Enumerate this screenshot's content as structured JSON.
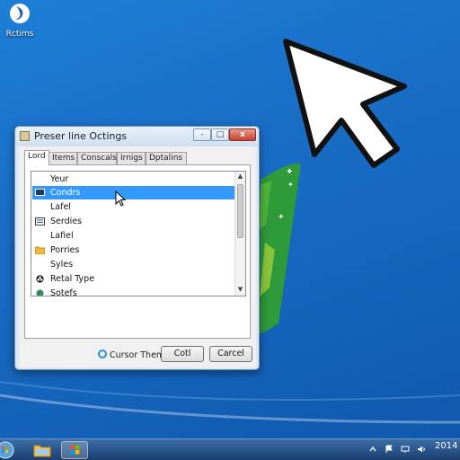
{
  "desktop": {
    "icon_label": "Rctims"
  },
  "dialog": {
    "title": "Preser line Octings",
    "controls": {
      "minimize": "-",
      "maximize": "□",
      "close": "x"
    },
    "tabs": [
      {
        "label": "Lord"
      },
      {
        "label": "Items"
      },
      {
        "label": "Conscals"
      },
      {
        "label": "Irnigs"
      },
      {
        "label": "Dptalins"
      }
    ],
    "list": {
      "items": [
        {
          "label": "Yeur",
          "icon": "none"
        },
        {
          "label": "Condrs",
          "icon": "monitor-icon",
          "selected": true
        },
        {
          "label": "Lafel",
          "icon": "none"
        },
        {
          "label": "Serdies",
          "icon": "list-icon"
        },
        {
          "label": "Lafiel",
          "icon": "none"
        },
        {
          "label": "Porries",
          "icon": "folder-icon"
        },
        {
          "label": "Syles",
          "icon": "none"
        },
        {
          "label": "Retal Type",
          "icon": "clover-icon"
        },
        {
          "label": "Sotefs",
          "icon": "globe-icon"
        }
      ],
      "scroll_up": "▲",
      "scroll_down": "▼"
    },
    "theme_link": "Cursor Theme",
    "ok_label": "Cotl",
    "cancel_label": "Carcel"
  },
  "taskbar": {
    "clock": "2014"
  },
  "colors": {
    "desktop": "#1a6ec6",
    "selection": "#3399ff",
    "dialog_frame": "#dce8f4"
  }
}
